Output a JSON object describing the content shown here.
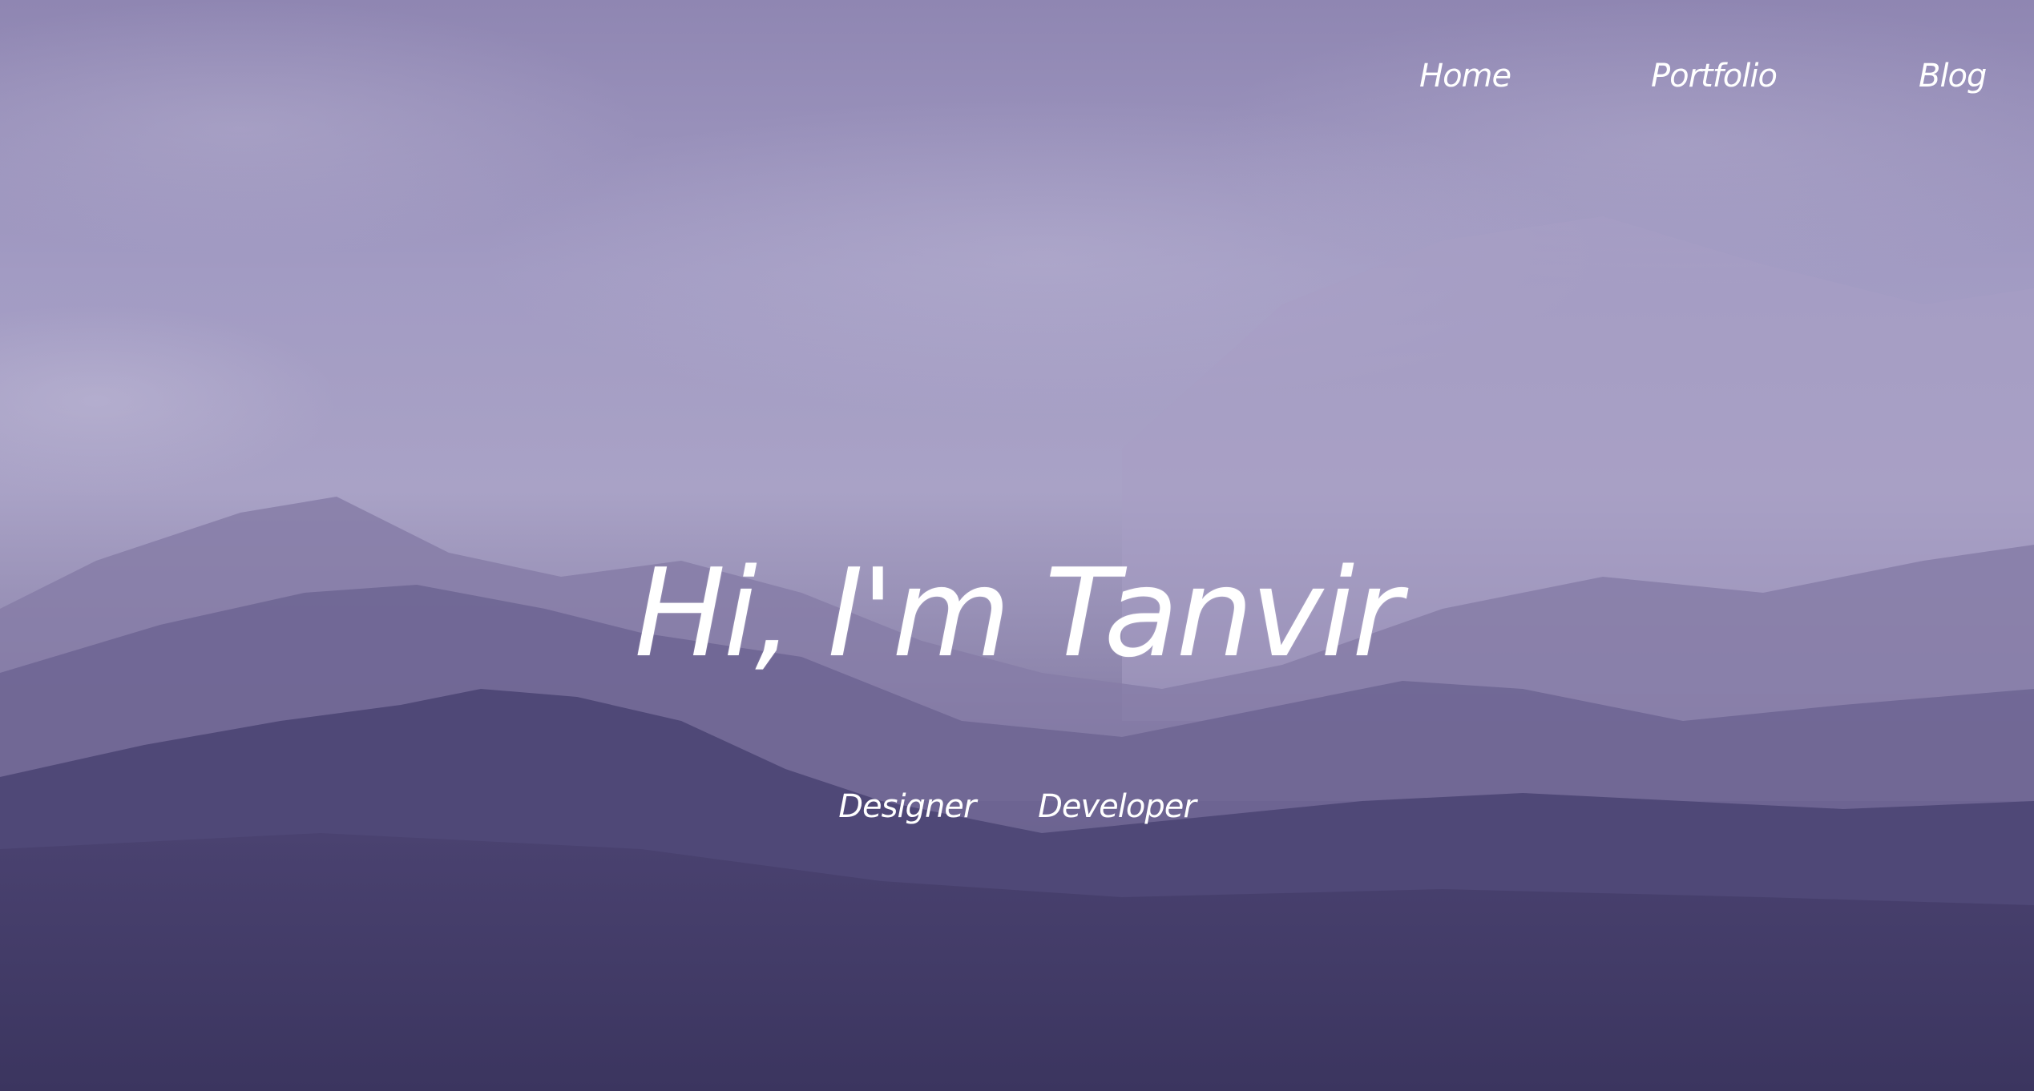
{
  "nav": {
    "items": [
      {
        "label": "Home"
      },
      {
        "label": "Portfolio"
      },
      {
        "label": "Blog"
      }
    ]
  },
  "hero": {
    "title": "Hi, I'm Tanvir",
    "roles": [
      "Designer",
      "Developer"
    ]
  },
  "colors": {
    "sky_top": "#8f86b2",
    "sky_mid": "#a9a2c6",
    "mountains_far": "#8e86ad",
    "mountains_near": "#3f3866",
    "text": "#ffffff"
  }
}
